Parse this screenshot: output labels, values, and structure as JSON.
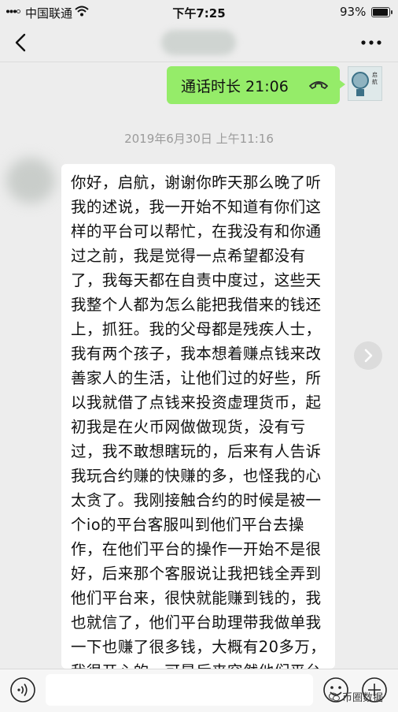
{
  "status_bar": {
    "carrier": "中国联通",
    "time": "下午7:25",
    "battery_percent": "93%",
    "battery_level": 0.93
  },
  "nav": {
    "back_icon": "chevron-left-icon",
    "more_icon": "more-dots-icon"
  },
  "call_message": {
    "text": "通话时长 21:06",
    "icon": "phone-hangup-icon",
    "bubble_color": "#95ec69"
  },
  "self_avatar": {
    "brand_text": "启航"
  },
  "timestamp": "2019年6月30日 上午11:16",
  "message": {
    "text": "你好，启航，谢谢你昨天那么晚了听我的述说，我一开始不知道有你们这样的平台可以帮忙，在我没有和你通过之前，我是觉得一点希望都没有了，我每天都在自责中度过，这些天我整个人都为怎么能把我借来的钱还上，抓狂。我的父母都是残疾人士，我有两个孩子，我本想着赚点钱来改善家人的生活，让他们过的好些，所以我就借了点钱来投资虚理货币，起初我是在火币网做做现货，没有亏过，我不敢想瞎玩的，后来有人告诉我玩合约赚的快赚的多，也怪我的心太贪了。我刚接触合约的时候是被一个io的平台客服叫到他们平台去操作，在他们平台的操作一开始不是很好，后来那个客服说让我把钱全弄到他们平台来，很快就能赚到钱的，我也就信了，他们平台助理带我做单我一下也赚了很多钱，大概有20多万，我很开心的，可是后来突然他们平台登不上了，我的钱也拿不出来了，我急啊，通过他们助"
  },
  "forward_icon": "forward-arrow-icon",
  "input_bar": {
    "voice_icon": "voice-icon",
    "emoji_icon": "emoji-icon",
    "add_icon": "plus-icon"
  },
  "watermark": "币圈数据"
}
